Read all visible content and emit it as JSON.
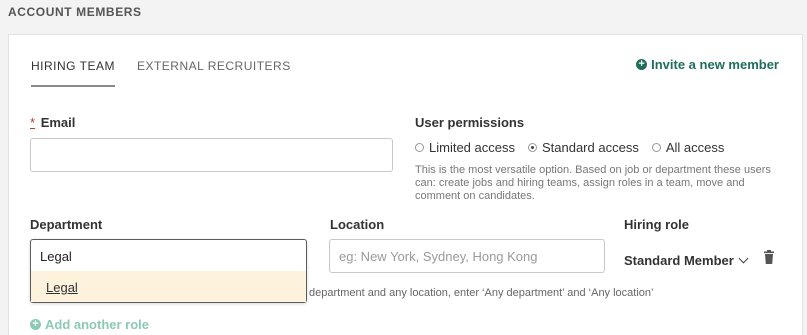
{
  "section": {
    "title": "ACCOUNT MEMBERS"
  },
  "tabs": [
    {
      "label": "HIRING TEAM",
      "active": true
    },
    {
      "label": "EXTERNAL RECRUITERS",
      "active": false
    }
  ],
  "invite": {
    "label": "Invite a new member",
    "icon": "plus-circle-icon"
  },
  "email": {
    "required_mark": "*",
    "label": "Email",
    "value": ""
  },
  "permissions": {
    "label": "User permissions",
    "options": [
      {
        "label": "Limited access",
        "checked": false
      },
      {
        "label": "Standard access",
        "checked": true
      },
      {
        "label": "All access",
        "checked": false
      }
    ],
    "help_text": "This is the most versatile option. Based on job or department these users can: create jobs and hiring teams, assign roles in a team, move and comment on candidates."
  },
  "department": {
    "label": "Department",
    "value": "Legal",
    "dropdown_option": "Legal"
  },
  "location": {
    "label": "Location",
    "placeholder": "eg: New York, Sydney, Hong Kong",
    "value": ""
  },
  "hiring_role": {
    "label": "Hiring role",
    "value": "Standard Member",
    "delete_icon": "trash-icon"
  },
  "hint": {
    "text": "department and any location, enter ‘Any department’ and ‘Any location’"
  },
  "add_role": {
    "label": "Add another role"
  },
  "colors": {
    "accent": "#1f6e5b",
    "accent_light": "#8cc9b6",
    "highlight": "#fdf3dc",
    "required": "#c0392b"
  }
}
